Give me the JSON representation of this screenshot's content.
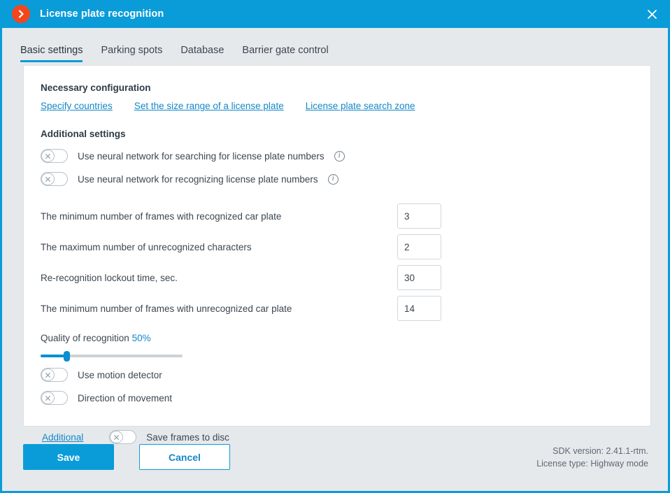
{
  "window": {
    "title": "License plate recognition",
    "logo_icon": "chevron-right-circle-icon",
    "close_icon": "close-icon"
  },
  "tabs": [
    {
      "label": "Basic settings",
      "active": true
    },
    {
      "label": "Parking spots",
      "active": false
    },
    {
      "label": "Database",
      "active": false
    },
    {
      "label": "Barrier gate control",
      "active": false
    }
  ],
  "necessary": {
    "title": "Necessary configuration",
    "links": [
      "Specify countries",
      "Set the size range of a license plate",
      "License plate search zone"
    ]
  },
  "additional_settings": {
    "title": "Additional settings",
    "toggles": [
      {
        "label": "Use neural network for searching for license plate numbers",
        "state": "off",
        "has_info": true
      },
      {
        "label": "Use neural network for recognizing license plate numbers",
        "state": "off",
        "has_info": true
      }
    ]
  },
  "fields": [
    {
      "label": "The minimum number of frames with recognized car plate",
      "value": "3"
    },
    {
      "label": "The maximum number of unrecognized characters",
      "value": "2"
    },
    {
      "label": "Re-recognition lockout time, sec.",
      "value": "30"
    },
    {
      "label": "The minimum number of frames with unrecognized car plate",
      "value": "14"
    }
  ],
  "quality": {
    "label": "Quality of recognition",
    "value_text": "50%",
    "percent": 18,
    "min": 0,
    "max": 100
  },
  "motion_toggles": [
    {
      "label": "Use motion detector",
      "state": "off"
    },
    {
      "label": "Direction of movement",
      "state": "off"
    }
  ],
  "additional_row": {
    "link": "Additional",
    "toggle_label": "Save frames to disc",
    "toggle_state": "off"
  },
  "footer": {
    "save_label": "Save",
    "cancel_label": "Cancel",
    "sdk_version": "SDK version: 2.41.1-rtm.",
    "license_type": "License type: Highway mode"
  },
  "colors": {
    "accent": "#0a9cd8",
    "link": "#1487c8",
    "logo": "#f2471d",
    "page_bg": "#e6e9ec",
    "card_bg": "#ffffff",
    "text": "#3c4651"
  }
}
